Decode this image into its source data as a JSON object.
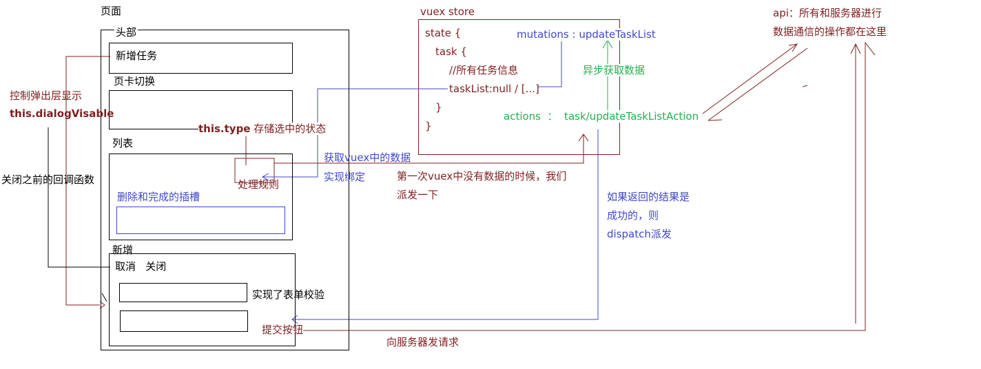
{
  "colors": {
    "maroon": "#7f1f1f",
    "blue": "#3f48cc",
    "green": "#22b14c",
    "black": "#000000"
  },
  "page": {
    "title": "页面",
    "header": {
      "label": "头部",
      "add_task": "新增任务"
    },
    "tab_switch": {
      "label": "页卡切换"
    },
    "list": {
      "label": "列表",
      "slot": "删除和完成的插槽",
      "process_rule": "处理规则"
    },
    "add": {
      "label": "新增",
      "cancel_close": "取消   关闭",
      "validation": "实现了表单校验",
      "submit": "提交按钮"
    }
  },
  "left_notes": {
    "control_popup": "控制弹出层显示",
    "dialog_var": "this.dialogVisable",
    "close_callback": "关闭之前的回调函数"
  },
  "type_note": {
    "code": "this.type",
    "text": " 存储选中的状态"
  },
  "middle_notes": {
    "get_vuex": "获取vuex中的数据",
    "binding": "实现绑定",
    "first_dispatch_line1": "第一次vuex中没有数据的时候，我们",
    "first_dispatch_line2": "派发一下"
  },
  "store": {
    "title": "vuex store",
    "code": [
      "state {",
      "task {",
      "//所有任务信息",
      "taskList:null / [...]",
      "}",
      "}"
    ],
    "mutations": "mutations : updateTaskList",
    "async_fetch": "异步获取数据",
    "actions": "actions  ：  task/updateTaskListAction"
  },
  "result_note": [
    "如果返回的结果是",
    "成功的，则",
    "dispatch派发"
  ],
  "api": {
    "line1": "api：所有和服务器进行",
    "line2": "数据通信的操作都在这里"
  },
  "server_request": "向服务器发请求"
}
